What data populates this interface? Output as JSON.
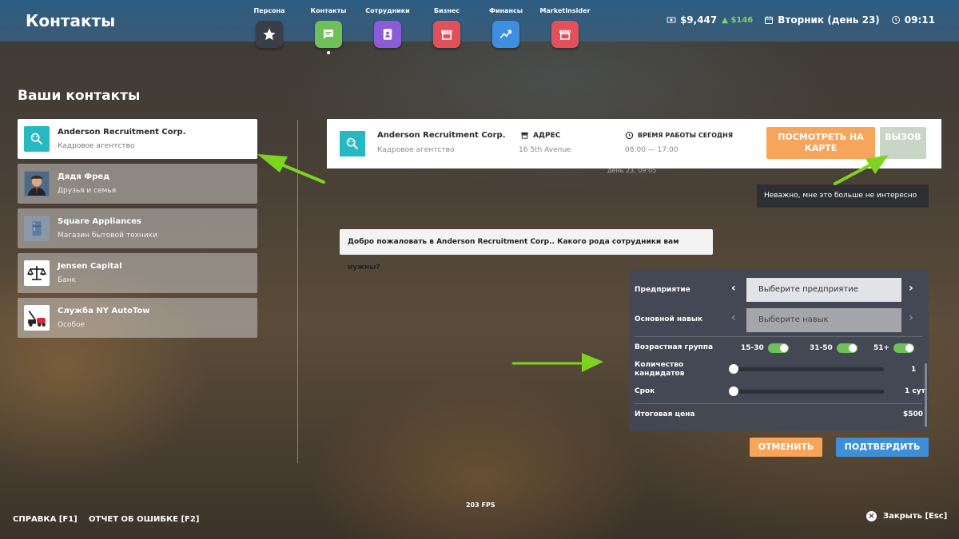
{
  "header": {
    "title": "Контакты",
    "nav": [
      {
        "label": "Персона",
        "icon": "star-icon",
        "color": "#3a3f47",
        "active": false
      },
      {
        "label": "Контакты",
        "icon": "chat-icon",
        "color": "#6fbf5a",
        "active": true
      },
      {
        "label": "Сотрудники",
        "icon": "badge-icon",
        "color": "#8c5bd6",
        "active": false
      },
      {
        "label": "Бизнес",
        "icon": "store-icon",
        "color": "#e2505b",
        "active": false
      },
      {
        "label": "Финансы",
        "icon": "chart-icon",
        "color": "#3f8ee0",
        "active": false
      },
      {
        "label": "MarketInsider",
        "icon": "store-icon",
        "color": "#e2505b",
        "active": false
      }
    ],
    "money": "$9,447",
    "money_delta": "$146",
    "day": "Вторник (день 23)",
    "time": "09:11"
  },
  "contacts": {
    "title": "Ваши контакты",
    "items": [
      {
        "name": "Anderson Recruitment Corp.",
        "type": "Кадровое агентство",
        "icon": "recruitment-logo-icon",
        "active": true
      },
      {
        "name": "Дядя Фред",
        "type": "Друзья и семья",
        "icon": "person-avatar-icon",
        "active": false
      },
      {
        "name": "Square Appliances",
        "type": "Магазин бытовой техники",
        "icon": "appliance-icon",
        "active": false
      },
      {
        "name": "Jensen Capital",
        "type": "Банк",
        "icon": "scales-icon",
        "active": false
      },
      {
        "name": "Служба NY AutoTow",
        "type": "Особое",
        "icon": "tow-truck-icon",
        "active": false
      }
    ]
  },
  "detail": {
    "name": "Anderson Recruitment Corp.",
    "type": "Кадровое агентство",
    "address_title": "АДРЕС",
    "address": "16 5th Avenue",
    "hours_title": "ВРЕМЯ РАБОТЫ СЕГОДНЯ",
    "hours": "08:00 — 17:00",
    "map_button": "ПОСМОТРЕТЬ НА КАРТЕ",
    "call_button": "ВЫЗОВ",
    "chat_date": "день 23, 09:05",
    "tooltip": "Неважно, мне это больше не интересно",
    "message": "Добро пожаловать в Anderson Recruitment Corp.. Какого рода сотрудники вам нужны?"
  },
  "form": {
    "enterprise_label": "Предприятие",
    "enterprise_value": "Выберите предприятие",
    "skill_label": "Основной навык",
    "skill_value": "Выберите навык",
    "age_label": "Возрастная группа",
    "age_groups": [
      {
        "label": "15-30",
        "on": true
      },
      {
        "label": "31-50",
        "on": true
      },
      {
        "label": "51+",
        "on": true
      }
    ],
    "count_label": "Количество кандидатов",
    "count_value": "1",
    "duration_label": "Срок",
    "duration_value": "1 сут",
    "total_label": "Итоговая цена",
    "total_value": "$500",
    "cancel": "ОТМЕНИТЬ",
    "confirm": "ПОДТВЕРДИТЬ"
  },
  "footer": {
    "fps": "203 FPS",
    "help": "СПРАВКА [F1]",
    "bug": "ОТЧЕТ ОБ ОШИБКЕ [F2]",
    "close": "Закрыть [Esc]"
  },
  "colors": {
    "accent_green": "#6fbf5a",
    "annotation_arrow": "#7ed321",
    "orange": "#f6a55a",
    "blue": "#3d8fd8"
  }
}
